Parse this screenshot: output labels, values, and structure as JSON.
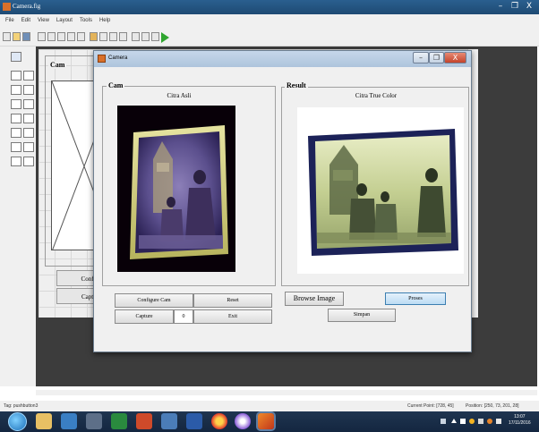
{
  "guide_window": {
    "title": "Camera.fig",
    "minimize_label": "–",
    "maximize_label": "❐",
    "close_label": "X",
    "menu": [
      "File",
      "Edit",
      "View",
      "Layout",
      "Tools",
      "Help"
    ]
  },
  "guide_canvas": {
    "cam_panel_title": "Cam",
    "configure_label": "Config",
    "capture_label": "Captur"
  },
  "status_bar": {
    "tag": "Tag: pushbutton3",
    "current_point": "Current Point: [728, 45]",
    "position": "Position: [250, 73, 201, 28]"
  },
  "camera_window": {
    "title": "Camera",
    "cam_panel": {
      "title": "Cam",
      "caption": "Citra Asli",
      "configure_button": "Configure Cam",
      "reset_button": "Reset",
      "capture_button": "Capture",
      "value_field": "0",
      "exit_button": "Exit"
    },
    "result_panel": {
      "title": "Result",
      "caption": "Citra True Color",
      "browse_button": "Browse Image",
      "process_button": "Proses",
      "save_button": "Simpan"
    }
  },
  "taskbar": {
    "time": "13:07",
    "date": "17/11/2016"
  },
  "colors": {
    "accent_blue": "#2a5f8f",
    "canvas_dark": "#3c3c3c",
    "taskbar": "#142640"
  }
}
